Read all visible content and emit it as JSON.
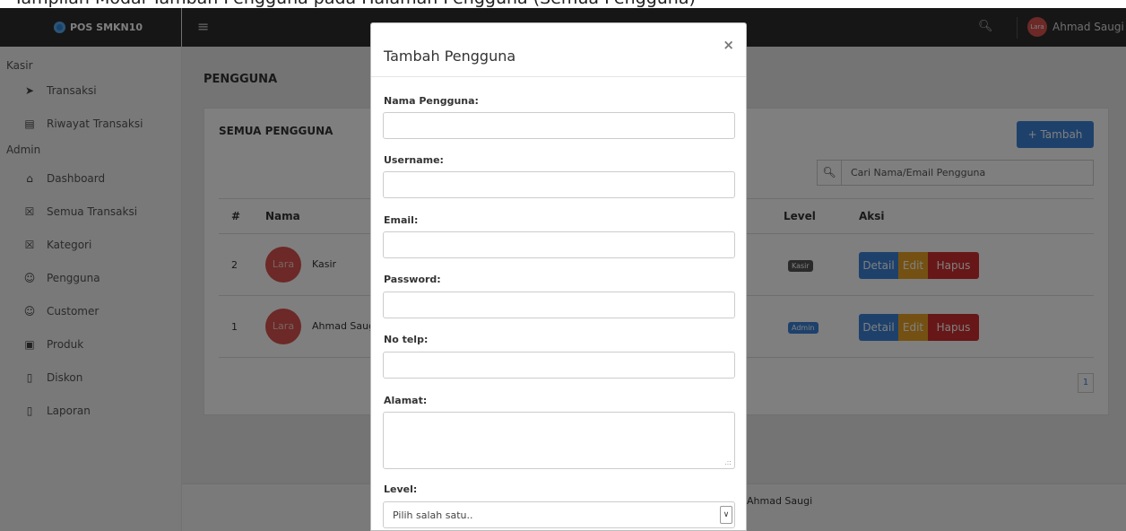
{
  "caption": "Tampilan Modal Tambah Pengguna pada Halaman Pengguna (Semua Pengguna)",
  "brand": "POS SMKN10",
  "topbar": {
    "user_name": "Ahmad Saugi",
    "avatar_text": "Lara"
  },
  "sidebar": {
    "sections": [
      {
        "title": "Kasir",
        "items": [
          {
            "label": "Transaksi",
            "icon": "rocket-icon"
          },
          {
            "label": "Riwayat Transaksi",
            "icon": "history-icon"
          }
        ]
      },
      {
        "title": "Admin",
        "items": [
          {
            "label": "Dashboard",
            "icon": "home-icon"
          },
          {
            "label": "Semua Transaksi",
            "icon": "basket-icon"
          },
          {
            "label": "Kategori",
            "icon": "basket-icon"
          },
          {
            "label": "Pengguna",
            "icon": "user-icon"
          },
          {
            "label": "Customer",
            "icon": "user-icon"
          },
          {
            "label": "Produk",
            "icon": "briefcase-icon"
          },
          {
            "label": "Diskon",
            "icon": "file-icon"
          },
          {
            "label": "Laporan",
            "icon": "file-icon"
          }
        ]
      }
    ]
  },
  "page": {
    "title": "PENGGUNA",
    "card_title": "SEMUA PENGGUNA",
    "add_button": "+ Tambah",
    "search_placeholder": "Cari Nama/Email Pengguna",
    "table": {
      "headers": {
        "num": "#",
        "name": "Nama",
        "level": "Level",
        "actions": "Aksi"
      },
      "rows": [
        {
          "num": "2",
          "avatar": "Lara",
          "name": "Kasir",
          "level": "Kasir",
          "level_color": "#555555"
        },
        {
          "num": "1",
          "avatar": "Lara",
          "name": "Ahmad Saugi",
          "level": "Admin",
          "level_color": "#3c82d9"
        }
      ],
      "actions": {
        "detail": "Detail",
        "edit": "Edit",
        "delete": "Hapus"
      }
    },
    "pagination_current": "1",
    "footer_text": "Ahmad Saugi"
  },
  "modal": {
    "title": "Tambah Pengguna",
    "close": "×",
    "fields": {
      "name": {
        "label": "Nama Pengguna:",
        "value": ""
      },
      "username": {
        "label": "Username:",
        "value": ""
      },
      "email": {
        "label": "Email:",
        "value": ""
      },
      "password": {
        "label": "Password:",
        "value": ""
      },
      "phone": {
        "label": "No telp:",
        "value": ""
      },
      "address": {
        "label": "Alamat:",
        "value": ""
      },
      "level": {
        "label": "Level:",
        "selected": "Pilih salah satu.."
      }
    }
  },
  "colors": {
    "primary": "#3c82d9",
    "warning": "#e8a325",
    "danger": "#cf2e2e",
    "dark": "#2c2c2c"
  }
}
